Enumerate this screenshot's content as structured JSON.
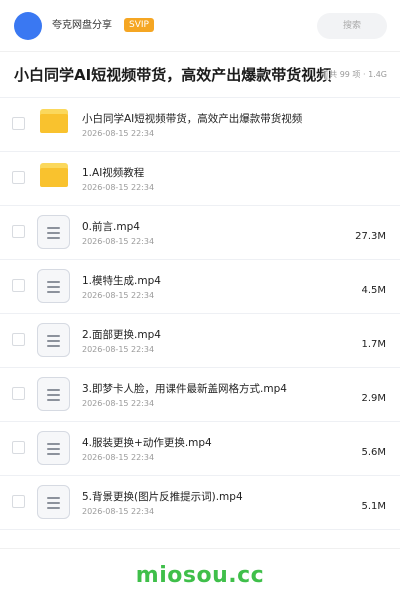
{
  "header": {
    "share_name": "夸克网盘分享",
    "badge": "SVIP",
    "search_placeholder": "搜索"
  },
  "folder": {
    "title": "小白同学AI短视频带货，高效产出爆款带货视频",
    "meta": "共 99 项 · 1.4G"
  },
  "items": [
    {
      "type": "folder",
      "name": "小白同学AI短视频带货，高效产出爆款带货视频",
      "date": "2026-08-15 22:34",
      "size": ""
    },
    {
      "type": "folder",
      "name": "1.AI视频教程",
      "date": "2026-08-15 22:34",
      "size": ""
    },
    {
      "type": "file",
      "name": "0.前言.mp4",
      "date": "2026-08-15 22:34",
      "size": "27.3M"
    },
    {
      "type": "file",
      "name": "1.模特生成.mp4",
      "date": "2026-08-15 22:34",
      "size": "4.5M"
    },
    {
      "type": "file",
      "name": "2.面部更换.mp4",
      "date": "2026-08-15 22:34",
      "size": "1.7M"
    },
    {
      "type": "file",
      "name": "3.即梦卡人脸，用课件最新盖网格方式.mp4",
      "date": "2026-08-15 22:34",
      "size": "2.9M"
    },
    {
      "type": "file",
      "name": "4.服装更换+动作更换.mp4",
      "date": "2026-08-15 22:34",
      "size": "5.6M"
    },
    {
      "type": "file",
      "name": "5.背景更换(图片反推提示词).mp4",
      "date": "2026-08-15 22:34",
      "size": "5.1M"
    }
  ],
  "footer": {
    "brand": "miosou.cc"
  },
  "colors": {
    "accent": "#3a78f2",
    "badge": "#f5a623",
    "folder": "#f9c22e",
    "brand": "#3fbf4a"
  }
}
